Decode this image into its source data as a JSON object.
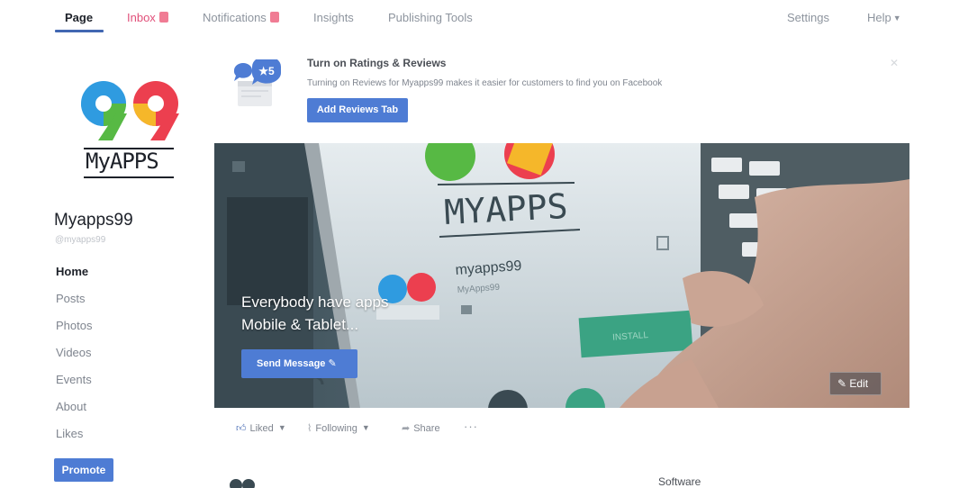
{
  "nav": {
    "page": "Page",
    "inbox": "Inbox",
    "notifications": "Notifications",
    "insights": "Insights",
    "publishing_tools": "Publishing Tools",
    "settings": "Settings",
    "help": "Help"
  },
  "profile": {
    "logo_number": "99",
    "logo_text": "MyAPPS",
    "name": "Myapps99",
    "handle": "@myapps99"
  },
  "sidebar": {
    "items": [
      "Home",
      "Posts",
      "Photos",
      "Videos",
      "Events",
      "About",
      "Likes"
    ],
    "promote": "Promote"
  },
  "reviews": {
    "badge": "★5",
    "title": "Turn on Ratings & Reviews",
    "description": "Turning on Reviews for Myapps99 makes it easier for customers to find you on Facebook",
    "button": "Add Reviews Tab"
  },
  "cover": {
    "phone_brand": "MYAPPS",
    "app_name": "myapps99",
    "app_handle": "MyApps99",
    "install_label": "INSTALL",
    "tagline_line1": "Everybody have apps",
    "tagline_line2": "Mobile & Tablet...",
    "send_message": "Send Message",
    "edit": "Edit"
  },
  "actions": {
    "liked": "Liked",
    "following": "Following",
    "share": "Share",
    "more": "···"
  },
  "about": {
    "category": "Software"
  },
  "colors": {
    "accent": "#4267b2",
    "button": "#4e7cd4",
    "badge": "#f07c94",
    "logo_blue": "#2f9be0",
    "logo_green": "#57b944",
    "logo_red": "#ec3f4f",
    "logo_yellow": "#f5b72a"
  }
}
